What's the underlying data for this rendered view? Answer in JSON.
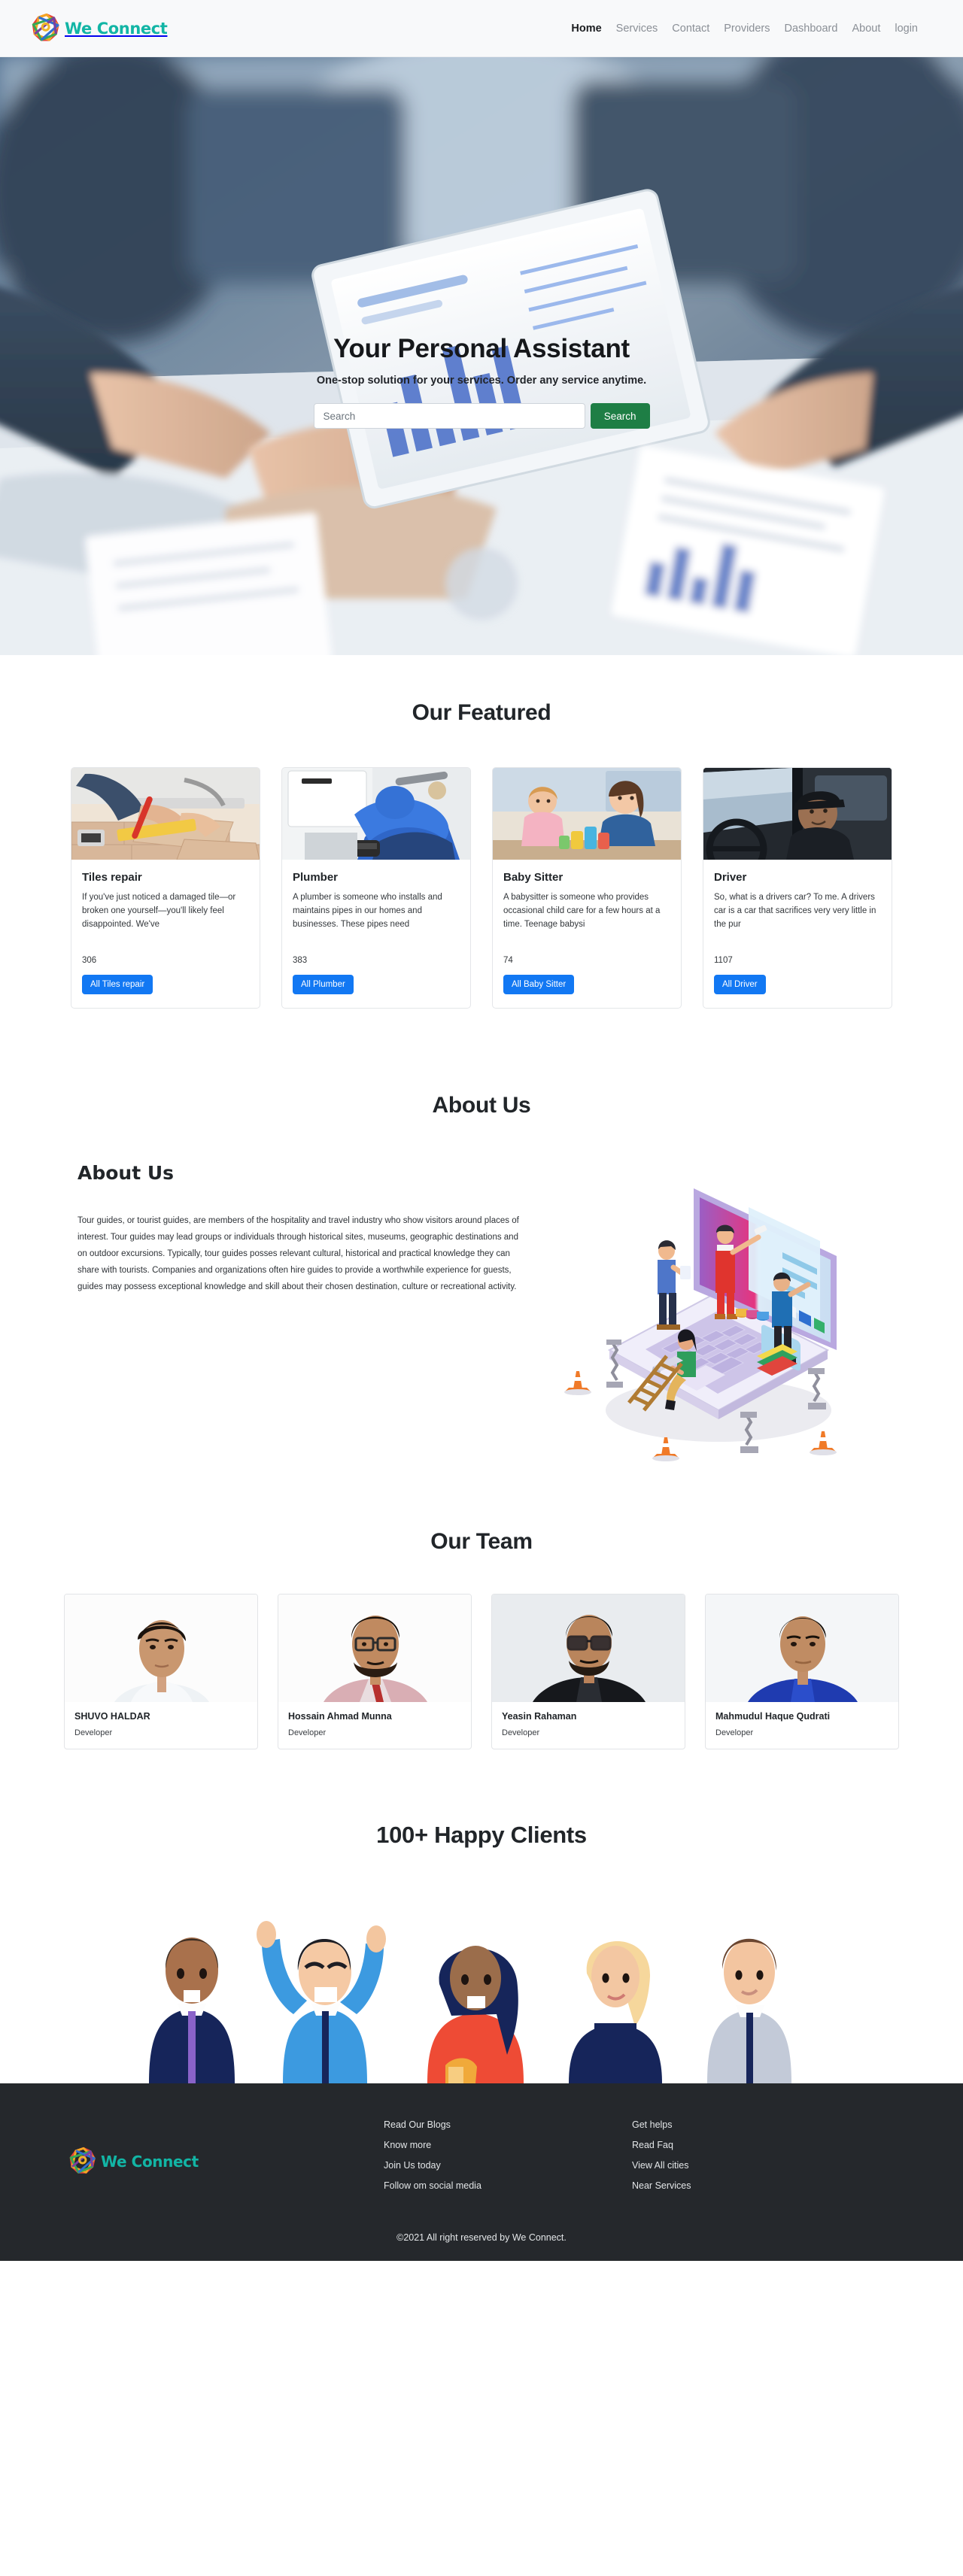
{
  "header": {
    "brand": {
      "name": "We Connect",
      "icon": "rosette-logo-icon",
      "color": "#12b5a5"
    },
    "nav": [
      {
        "label": "Home",
        "active": true
      },
      {
        "label": "Services",
        "active": false
      },
      {
        "label": "Contact",
        "active": false
      },
      {
        "label": "Providers",
        "active": false
      },
      {
        "label": "Dashboard",
        "active": false
      },
      {
        "label": "About",
        "active": false
      },
      {
        "label": "login",
        "active": false
      }
    ]
  },
  "hero": {
    "title": "Your Personal Assistant",
    "subtitle": "One-stop solution for your services. Order any service anytime.",
    "search_value": "",
    "search_placeholder": "Search",
    "search_button": "Search",
    "search_button_color": "#1e7e45",
    "background": "office-desk-tablet-documents-photo"
  },
  "featured": {
    "title": "Our Featured",
    "button_color": "#1278f3",
    "cards": [
      {
        "title": "Tiles repair",
        "description": "If you've just noticed a damaged tile—or broken one yourself—you'll likely feel disappointed. We've",
        "count": "306",
        "button": "All Tiles repair",
        "image": "tile-repair-photo"
      },
      {
        "title": "Plumber",
        "description": "A plumber is someone who installs and maintains pipes in our homes and businesses. These pipes need",
        "count": "383",
        "button": "All Plumber",
        "image": "plumber-photo"
      },
      {
        "title": "Baby Sitter",
        "description": "A babysitter is someone who provides occasional child care for a few hours at a time. Teenage babysi",
        "count": "74",
        "button": "All Baby Sitter",
        "image": "babysitter-photo"
      },
      {
        "title": "Driver",
        "description": "So, what is a drivers car? To me. A drivers car is a car that sacrifices very very little in the pur",
        "count": "1107",
        "button": "All Driver",
        "image": "driver-photo"
      }
    ]
  },
  "about": {
    "section_title": "About Us",
    "heading": "About Us",
    "paragraph": "Tour guides, or tourist guides, are members of the hospitality and travel industry who show visitors around places of interest. Tour guides may lead groups or individuals through historical sites, museums, geographic destinations and on outdoor excursions. Typically, tour guides posses relevant cultural, historical and practical knowledge they can share with tourists. Companies and organizations often hire guides to provide a worthwhile experience for guests, guides may possess exceptional knowledge and skill about their chosen destination, culture or recreational activity.",
    "illustration": "isometric-laptop-team-building-illustration"
  },
  "team": {
    "title": "Our Team",
    "members": [
      {
        "name": "SHUVO HALDAR",
        "role": "Developer",
        "photo": "portrait-white-shirt"
      },
      {
        "name": "Hossain Ahmad Munna",
        "role": "Developer",
        "photo": "portrait-pink-shirt-glasses"
      },
      {
        "name": "Yeasin Rahaman",
        "role": "Developer",
        "photo": "portrait-black-shirt-glasses"
      },
      {
        "name": "Mahmudul Haque Qudrati",
        "role": "Developer",
        "photo": "portrait-blue-shirt"
      }
    ]
  },
  "clients": {
    "title": "100+ Happy Clients",
    "illustration": "five-cheering-people-illustration"
  },
  "footer": {
    "brand": {
      "name": "We Connect",
      "icon": "rosette-logo-icon"
    },
    "col1": [
      {
        "label": "Read Our Blogs"
      },
      {
        "label": "Know more"
      },
      {
        "label": "Join Us today"
      },
      {
        "label": "Follow om social media"
      }
    ],
    "col2": [
      {
        "label": "Get helps"
      },
      {
        "label": "Read Faq"
      },
      {
        "label": "View All cities"
      },
      {
        "label": "Near Services"
      }
    ],
    "copyright": "©2021 All right reserved by We Connect."
  }
}
